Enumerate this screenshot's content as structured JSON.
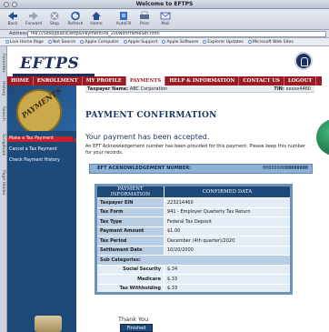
{
  "window": {
    "title": "Welcome to EFTPS"
  },
  "toolbar": {
    "buttons": [
      {
        "label": "Back"
      },
      {
        "label": "Forward"
      },
      {
        "label": "Stop"
      },
      {
        "label": "Refresh"
      },
      {
        "label": "Home"
      },
      {
        "label": "AutoFill"
      },
      {
        "label": "Print"
      },
      {
        "label": "Mail"
      }
    ]
  },
  "address": {
    "label": "Address",
    "url": "file:///Sites/public/eftps/Payment/Pb_200NonFrameSet.html"
  },
  "favorites": [
    "Live Home Page",
    "Net Search",
    "Apple Computer",
    "Apple Support",
    "Apple Software",
    "Explorer Updates",
    "Microsoft Web Sites"
  ],
  "sidetabs": [
    "Favorites",
    "History",
    "Search",
    "Scrapbook",
    "Page Holder"
  ],
  "site": {
    "logo": "EFTPS",
    "nav": [
      "HOME",
      "ENROLLMENT",
      "MY PROFILE",
      "PAYMENTS",
      "HELP & INFORMATION",
      "CONTACT US",
      "LOGOUT"
    ],
    "nav_active_index": 3,
    "badge_text": "PAYMENTS"
  },
  "left_menu": [
    {
      "label": "Make a Tax Payment",
      "active": true
    },
    {
      "label": "Cancel a Tax Payment",
      "active": false
    },
    {
      "label": "Check Payment History",
      "active": false
    }
  ],
  "payer": {
    "name_label": "Taxpayer Name:",
    "name": "ABC Corporation",
    "tin_label": "TIN:",
    "tin": "xxxxx4460"
  },
  "page_title": "PAYMENT CONFIRMATION",
  "accepted": "Your payment has been accepted.",
  "note": "An EFT Acknowledgement number has been provided for this payment. Please keep this number for your records.",
  "ack": {
    "label": "EFT ACKNOWLEDGEMENT NUMBER:",
    "num_prefix": "00000000",
    "num_bold": "00000000"
  },
  "table": {
    "headers": [
      "PAYMENT INFORMATION",
      "CONFIRMED DATA"
    ],
    "rows": [
      {
        "k": "Taxpayer EIN",
        "v": "223214460"
      },
      {
        "k": "Tax Form",
        "v": "941 - Employer Quarterly Tax Return"
      },
      {
        "k": "Tax Type",
        "v": "Federal Tax Deposit"
      },
      {
        "k": "Payment Amount",
        "v": "$1.00"
      },
      {
        "k": "Tax Period",
        "v": "December (4th quarter)/2020"
      },
      {
        "k": "Settlement Date",
        "v": "10/20/2000"
      }
    ],
    "sub_label": "Sub Categories:",
    "subrows": [
      {
        "k": "Social Security",
        "v": "$.34"
      },
      {
        "k": "Medicare",
        "v": "$.33"
      },
      {
        "k": "Tax Withholding",
        "v": "$.33"
      }
    ]
  },
  "thanks": "Thank You",
  "finish": "Finished"
}
